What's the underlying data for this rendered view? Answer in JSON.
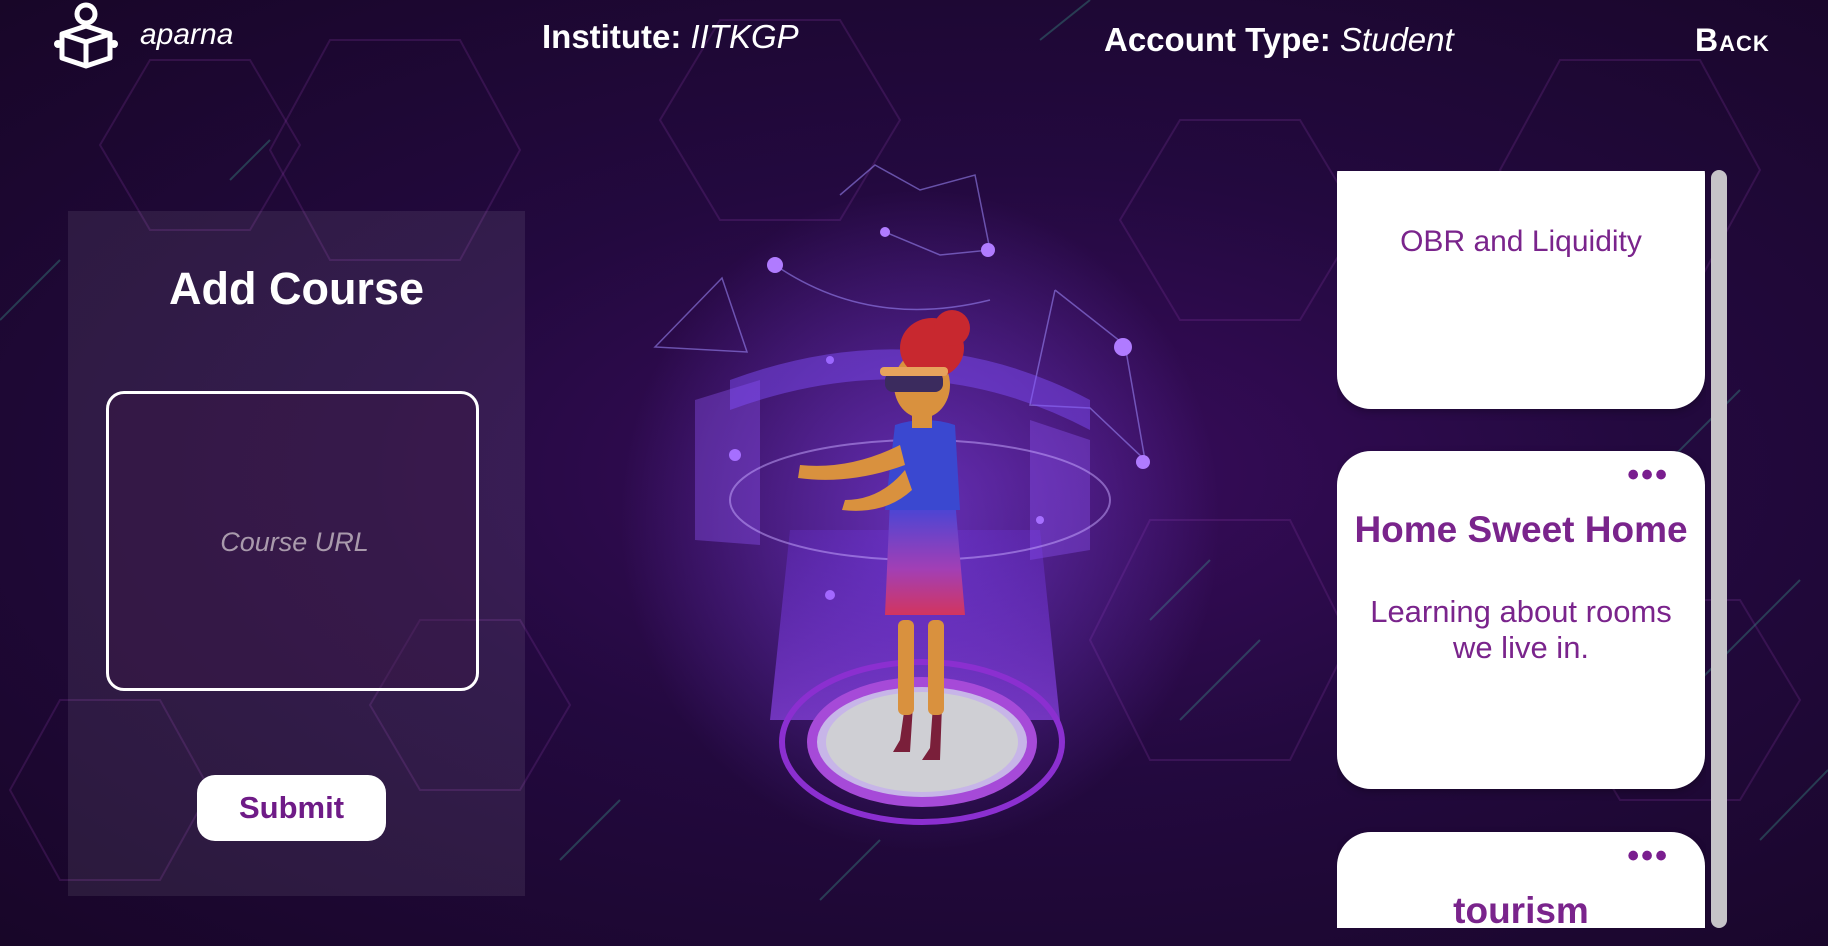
{
  "header": {
    "username": "aparna",
    "institute_label": "Institute:",
    "institute_value": "IITKGP",
    "account_label": "Account Type:",
    "account_value": "Student",
    "back_label": "Back"
  },
  "add_course": {
    "title": "Add Course",
    "url_placeholder": "Course URL",
    "url_value": "",
    "submit_label": "Submit"
  },
  "courses": [
    {
      "title": "OBR and Liquidity",
      "description": ""
    },
    {
      "title": "Home Sweet Home",
      "description": "Learning about rooms we live in.",
      "menu": "•••"
    },
    {
      "title": "tourism",
      "description": "",
      "menu": "•••"
    }
  ],
  "colors": {
    "background": "#23093f",
    "accent": "#7a248c",
    "card_bg": "#ffffff",
    "scrollbar": "#c6c3c8"
  },
  "icons": {
    "logo": "student-book-icon",
    "card_menu": "more-dots-icon"
  }
}
